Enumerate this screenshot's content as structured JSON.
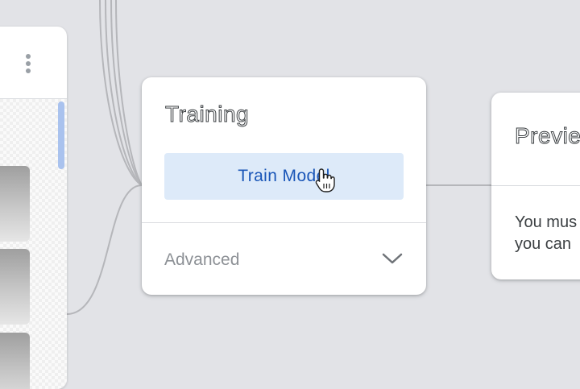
{
  "left_panel": {
    "menu_icon": "more-vert-icon"
  },
  "training_card": {
    "title": "Training",
    "train_button_label": "Train Model",
    "advanced_label": "Advanced",
    "expand_icon": "chevron-down-icon"
  },
  "preview_card": {
    "title": "Previe",
    "message_line1": "You mus",
    "message_line2": "you can"
  },
  "cursor": {
    "icon": "hand-pointer-icon"
  },
  "colors": {
    "canvas": "#e2e3e7",
    "card": "#ffffff",
    "button_bg": "#ddeaf9",
    "button_text": "#1a56b8",
    "muted_text": "#8d9196",
    "connector": "#b5b6ba",
    "scrollbar": "#a9c2ee"
  }
}
